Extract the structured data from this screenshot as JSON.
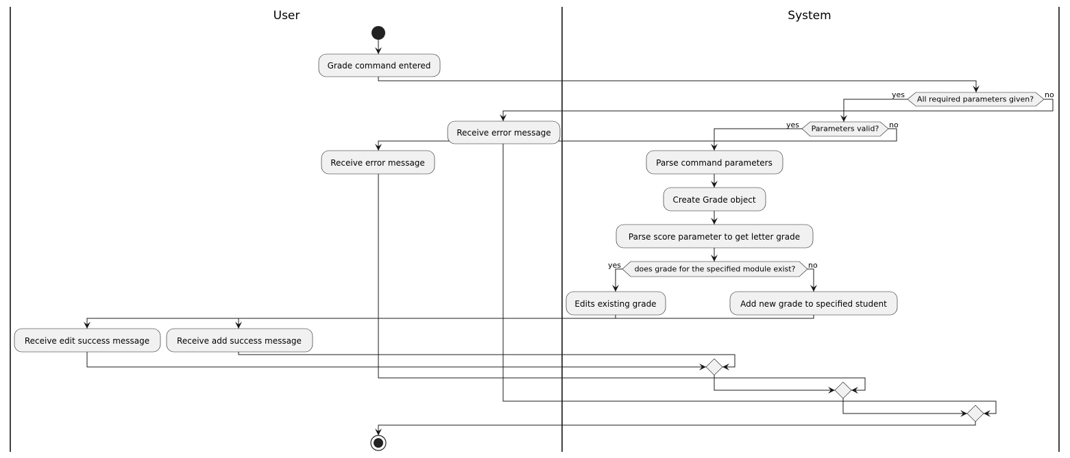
{
  "swimlanes": [
    {
      "title": "User"
    },
    {
      "title": "System"
    }
  ],
  "actions": {
    "grade_command": "Grade command entered",
    "error_missing": "Receive error message",
    "error_invalid": "Receive error message",
    "parse_command": "Parse command parameters",
    "create_grade": "Create Grade object",
    "parse_score": "Parse score parameter to get letter grade",
    "edit_grade": "Edits existing grade",
    "add_grade": "Add new grade to specified student",
    "edit_success": "Receive edit success message",
    "add_success": "Receive add success message"
  },
  "decisions": {
    "params_given": {
      "text": "All required parameters given?",
      "yes": "yes",
      "no": "no"
    },
    "params_valid": {
      "text": "Parameters valid?",
      "yes": "yes",
      "no": "no"
    },
    "grade_exists": {
      "text": "does grade for the specified module exist?",
      "yes": "yes",
      "no": "no"
    }
  },
  "colors": {
    "node_fill": "#f1f1f1",
    "line": "#181818",
    "start_end": "#222222"
  }
}
